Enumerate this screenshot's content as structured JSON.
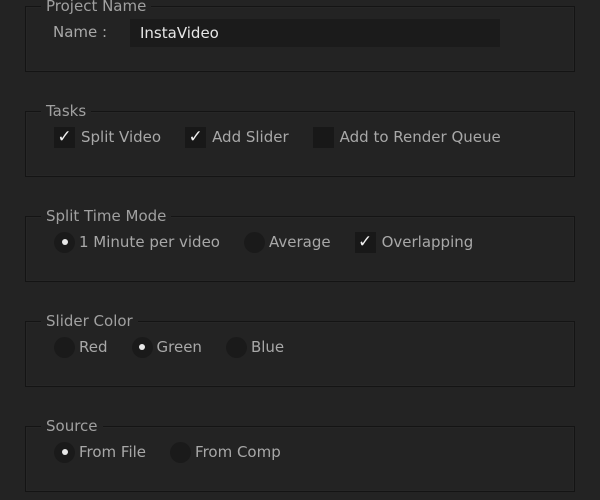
{
  "project": {
    "title": "Project Name",
    "name_label": "Name :",
    "name_value": "InstaVideo"
  },
  "tasks": {
    "title": "Tasks",
    "items": [
      {
        "label": "Split Video",
        "checked": true
      },
      {
        "label": "Add Slider",
        "checked": true
      },
      {
        "label": "Add to Render Queue",
        "checked": false
      }
    ]
  },
  "split_mode": {
    "title": "Split Time Mode",
    "radio1": "1 Minute per video",
    "radio2": "Average",
    "check": "Overlapping",
    "selected": "1 Minute per video",
    "overlapping_checked": true
  },
  "slider_color": {
    "title": "Slider Color",
    "options": [
      "Red",
      "Green",
      "Blue"
    ],
    "selected": "Green"
  },
  "source": {
    "title": "Source",
    "options": [
      "From File",
      "From Comp"
    ],
    "selected": "From File"
  },
  "glyphs": {
    "check": "✓"
  }
}
